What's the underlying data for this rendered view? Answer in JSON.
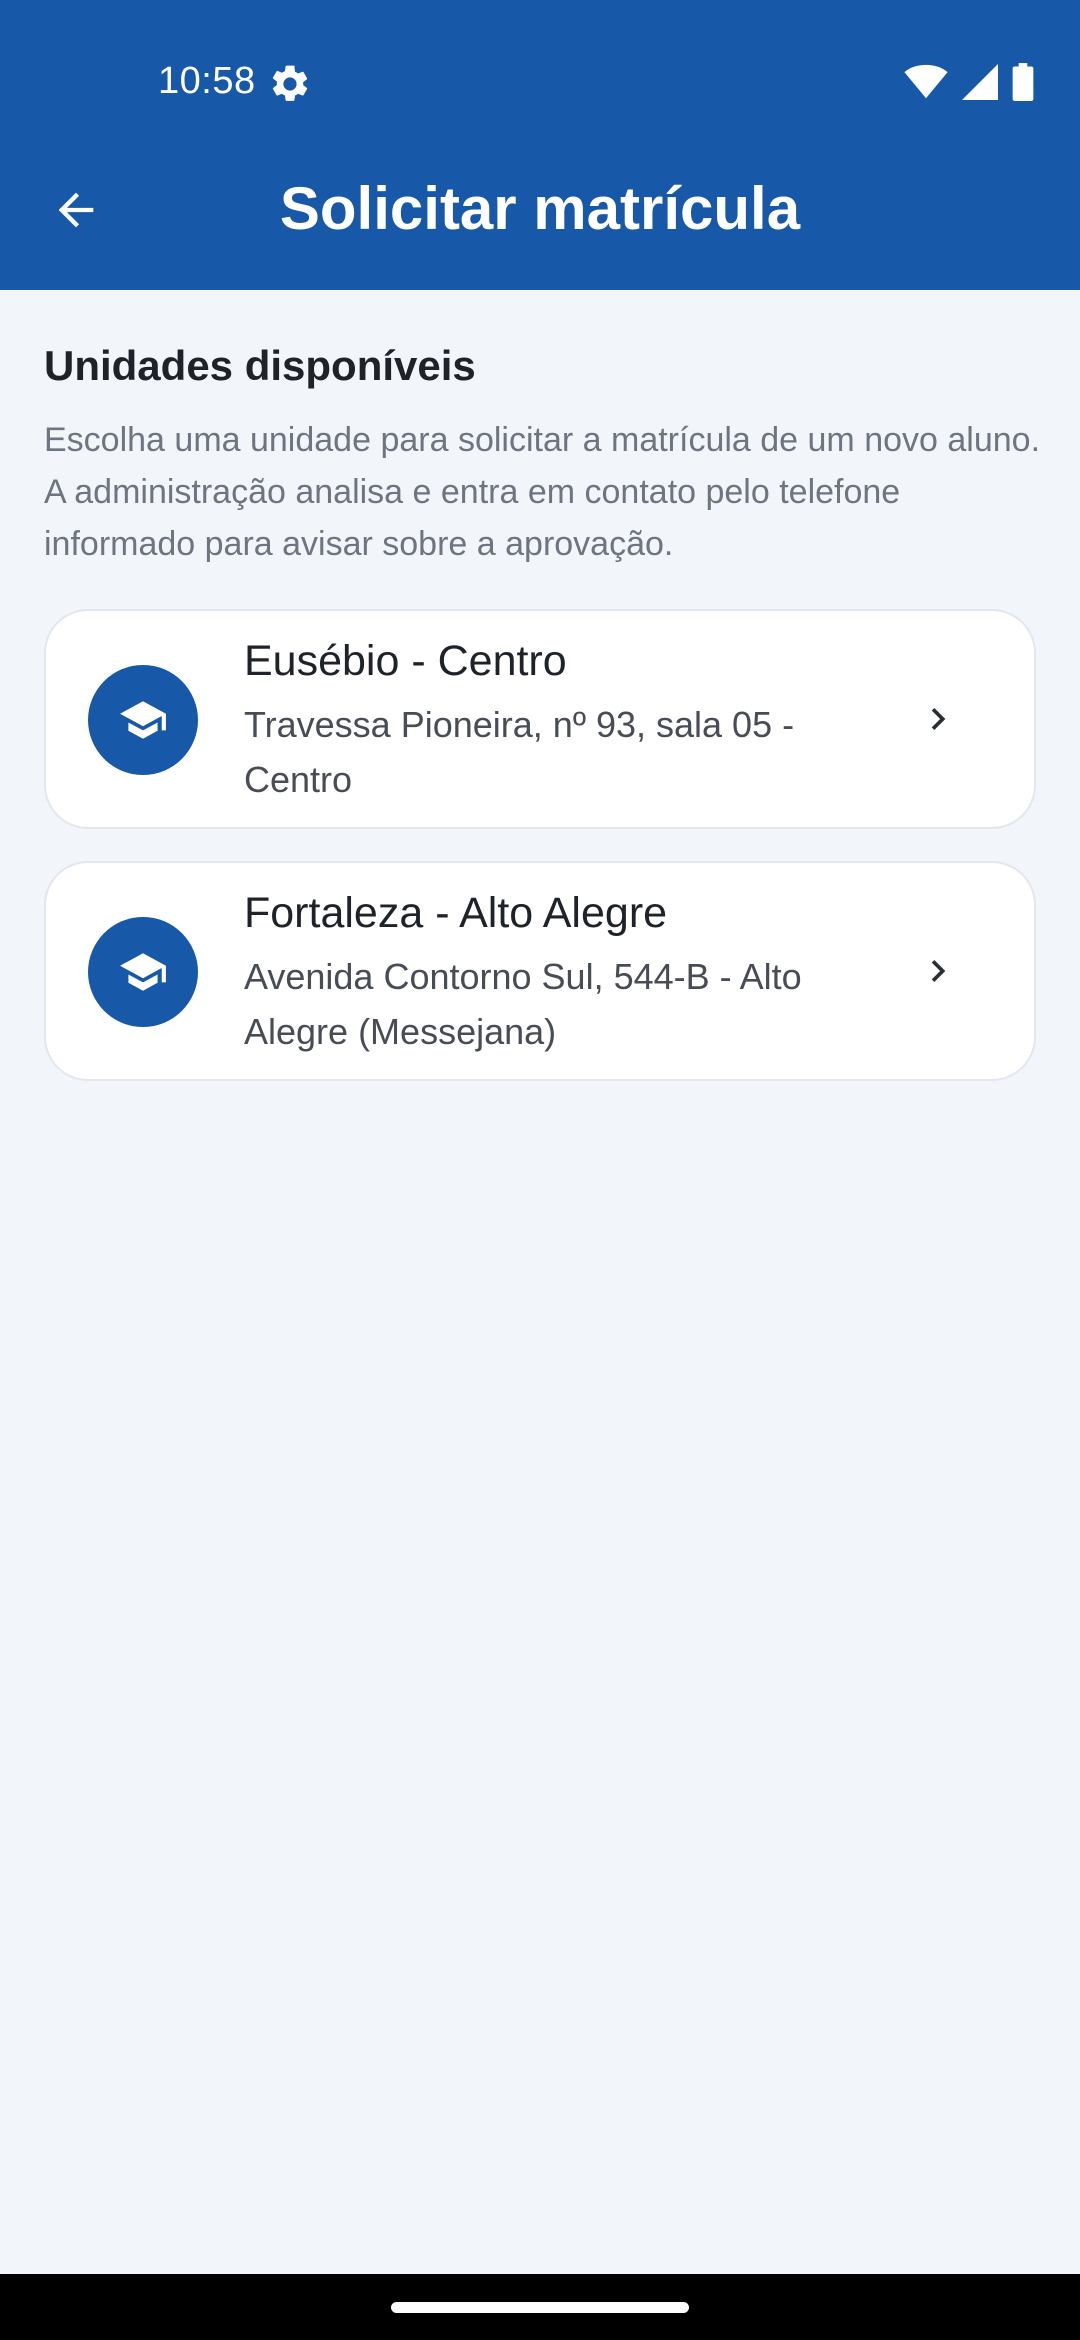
{
  "status_bar": {
    "time": "10:58",
    "icons": [
      "settings-icon",
      "wifi-icon",
      "cellular-signal-icon",
      "battery-icon"
    ]
  },
  "toolbar": {
    "back_icon": "arrow-back-icon",
    "title": "Solicitar matrícula"
  },
  "section": {
    "title": "Unidades disponíveis",
    "description": "Escolha uma unidade para solicitar a matrícula de um novo aluno. A administração analisa e entra em contato pelo telefone informado para avisar sobre a aprovação."
  },
  "units": [
    {
      "name": "Eusébio - Centro",
      "address": "Travessa Pioneira, nº 93, sala 05 - Centro",
      "icon": "graduation-cap-icon"
    },
    {
      "name": "Fortaleza - Alto Alegre",
      "address": "Avenida Contorno Sul, 544-B - Alto Alegre (Messejana)",
      "icon": "graduation-cap-icon"
    }
  ],
  "colors": {
    "primary": "#1858A8",
    "background": "#F2F5FA",
    "card": "#FFFFFF",
    "card_border": "#E1E6EF",
    "title_text": "#1E2229",
    "secondary_text": "#6F7580"
  }
}
